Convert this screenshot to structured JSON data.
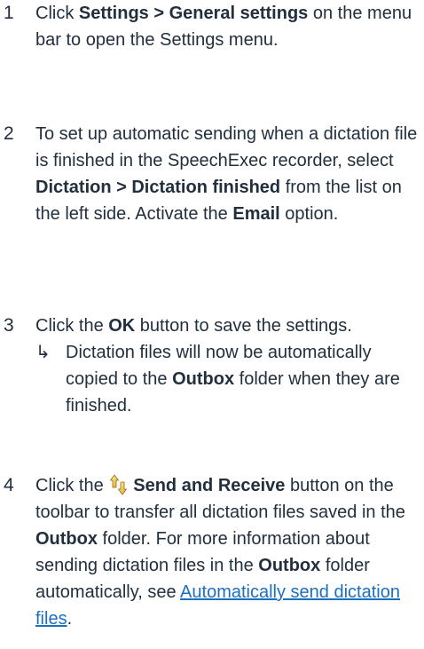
{
  "steps": [
    {
      "num": "1",
      "a1": "Click ",
      "b1": "Settings > General settings",
      "a2": " on the menu bar to open the Settings menu."
    },
    {
      "num": "2",
      "a1": "To set up automatic sending when a dictation file is finished in the SpeechExec recorder, select ",
      "b1": "Dictation > Dictation finished",
      "a2": " from the list on the left side. Activate the ",
      "b2": "Email",
      "a3": " option."
    },
    {
      "num": "3",
      "a1": "Click the ",
      "b1": "OK",
      "a2": " button to save the settings.",
      "result_arrow": "↳",
      "result_a1": "Dictation files will now be automatically copied to the ",
      "result_b1": "Outbox",
      "result_a2": " folder when they are finished."
    },
    {
      "num": "4",
      "a1": "Click the ",
      "icon": "send-receive-icon",
      "b1": "Send and Receive",
      "a2": " button on the toolbar to transfer all dictation files saved in the ",
      "b2": "Outbox",
      "a3": " folder. For more information about sending dictation files in the ",
      "b3": "Outbox",
      "a4": " folder automatically, see ",
      "link": "Automatically send dictation files",
      "a5": "."
    }
  ],
  "colors": {
    "text": "#222f3e",
    "link": "#1a6fbe"
  }
}
